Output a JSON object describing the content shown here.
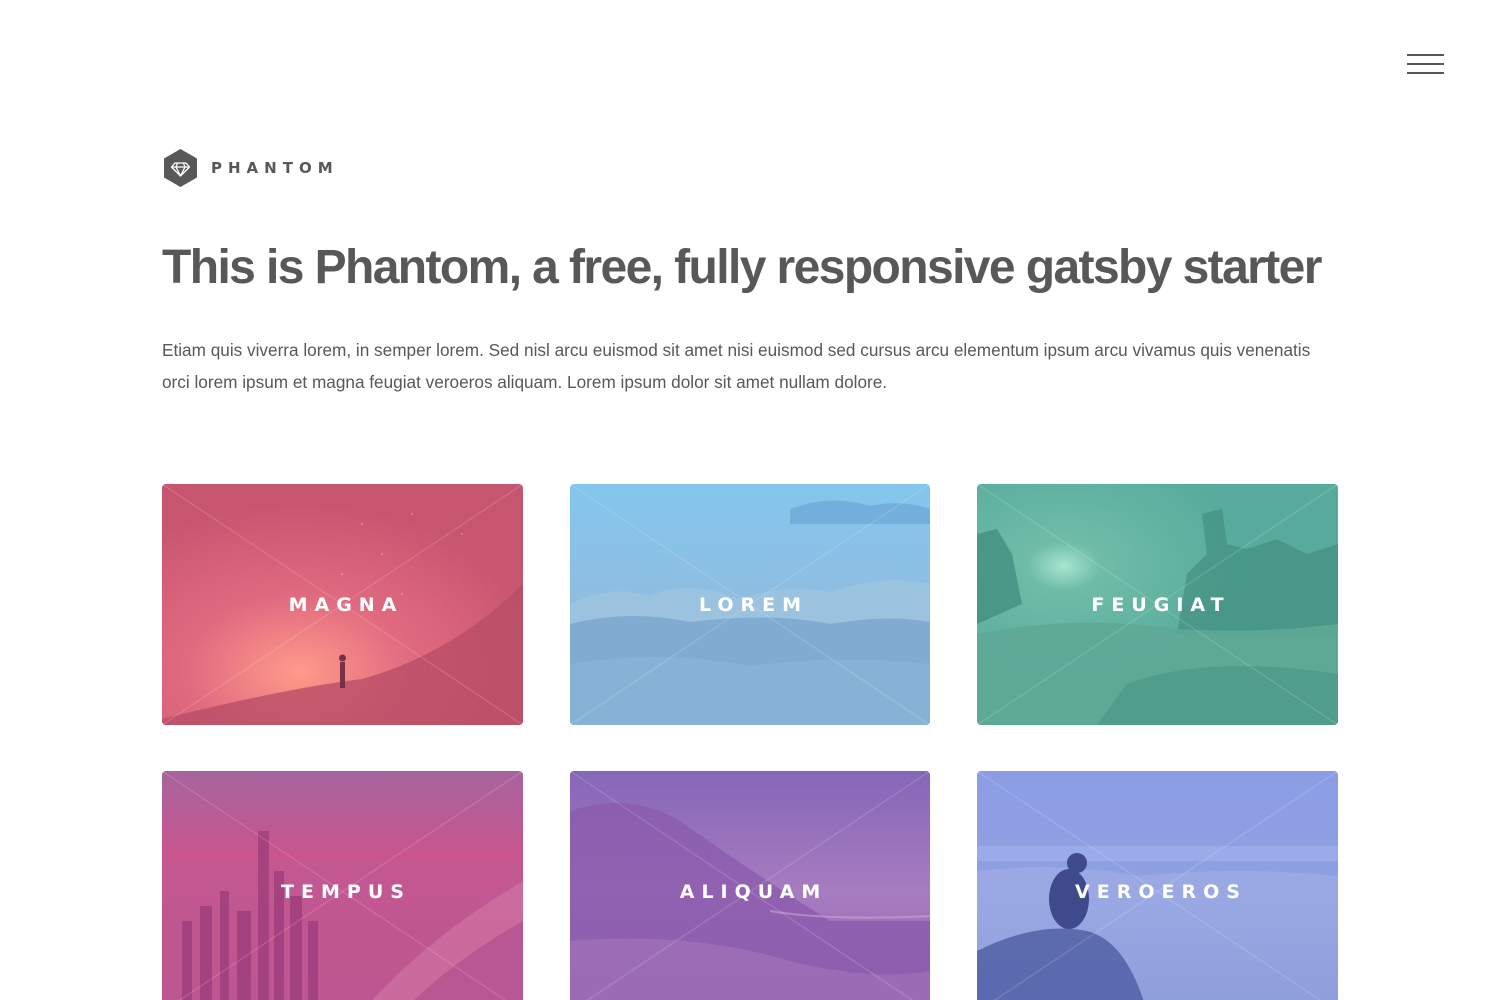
{
  "brand": {
    "name": "PHANTOM",
    "icon": "diamond-hexagon-icon"
  },
  "menu": {
    "icon": "hamburger-menu-icon"
  },
  "hero": {
    "title": "This is Phantom, a free, fully responsive gatsby starter",
    "description": "Etiam quis viverra lorem, in semper lorem. Sed nisl arcu euismod sit amet nisi euismod sed cursus arcu elementum ipsum arcu vivamus quis venenatis orci lorem ipsum et magna feugiat veroeros aliquam. Lorem ipsum dolor sit amet nullam dolore."
  },
  "tiles": [
    {
      "label": "MAGNA",
      "tint": "#e0526e",
      "scene": "night-sky-silhouette"
    },
    {
      "label": "LOREM",
      "tint": "#6bb7e6",
      "scene": "mountain-clouds"
    },
    {
      "label": "FEUGIAT",
      "tint": "#4ea99a",
      "scene": "desert-rocks"
    },
    {
      "label": "TEMPUS",
      "tint": "#c5408c",
      "scene": "coastal-city"
    },
    {
      "label": "ALIQUAM",
      "tint": "#8e5cb5",
      "scene": "mountain-road"
    },
    {
      "label": "VEROEROS",
      "tint": "#6b7fd6",
      "scene": "sea-of-clouds"
    }
  ]
}
